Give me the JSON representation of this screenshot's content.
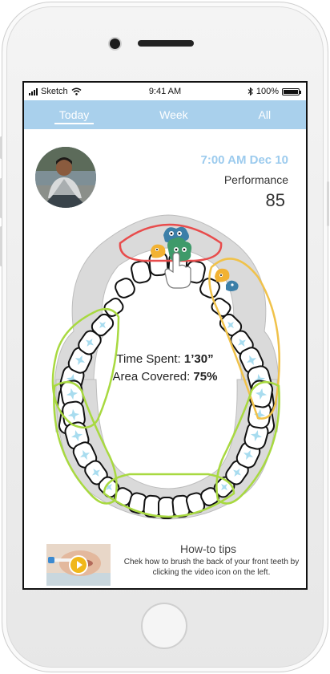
{
  "status_bar": {
    "carrier": "Sketch",
    "time": "9:41 AM",
    "battery": "100%"
  },
  "tabs": [
    {
      "label": "Today",
      "active": true
    },
    {
      "label": "Week",
      "active": false
    },
    {
      "label": "All",
      "active": false
    }
  ],
  "header": {
    "datetime": "7:00 AM  Dec 10",
    "performance_label": "Performance",
    "performance_value": "85"
  },
  "stats": {
    "time_label": "Time Spent:",
    "time_value": "1’30”",
    "area_label": "Area Covered:",
    "area_value": "75%"
  },
  "tips": {
    "title": "How-to tips",
    "text": "Chek how to brush the back of your front teeth by clicking the video icon on the left."
  },
  "colors": {
    "accent": "#a9d0ec",
    "date": "#9ccbee",
    "zone_green": "#a8d940",
    "zone_red": "#e84c4c",
    "zone_yellow": "#f0c24a"
  }
}
